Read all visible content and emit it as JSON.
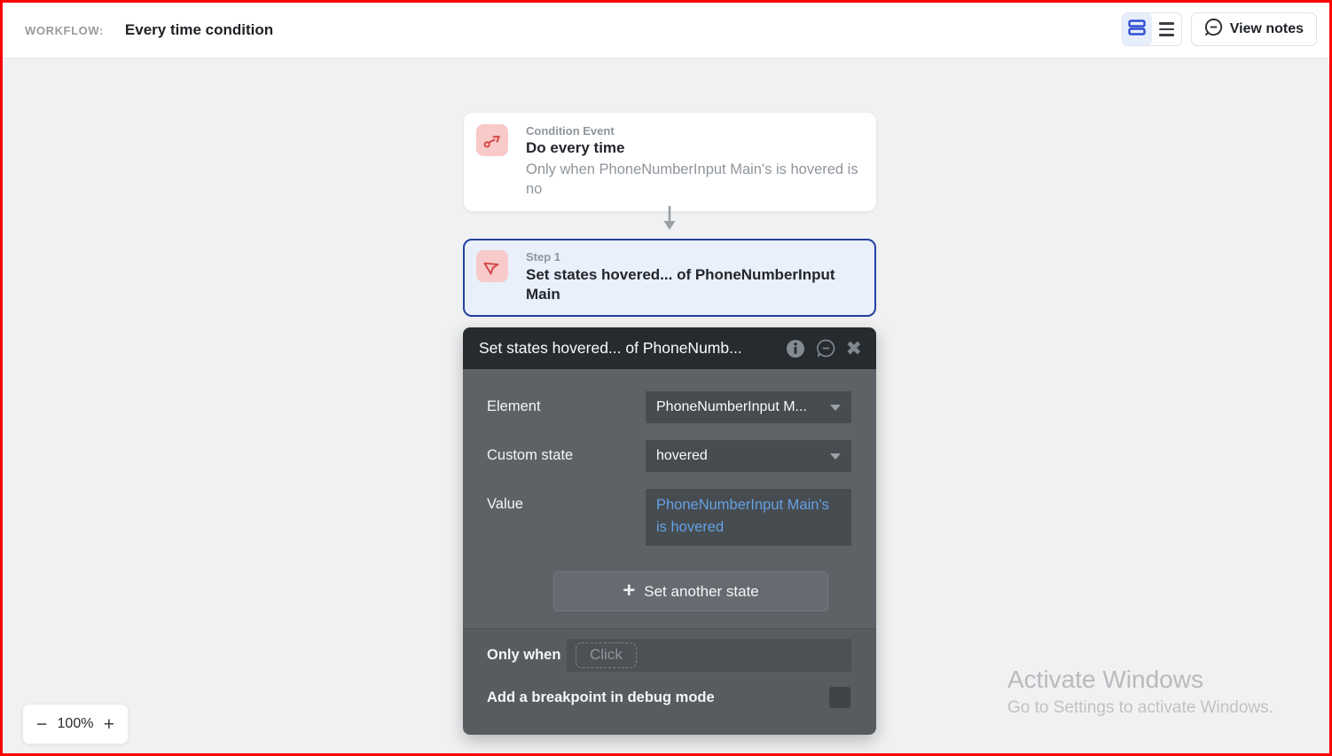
{
  "topbar": {
    "workflow_label": "WORKFLOW:",
    "title": "Every time condition",
    "view_notes_label": "View notes"
  },
  "canvas": {
    "condition_event": {
      "kind_label": "Condition Event",
      "title": "Do every time",
      "description": "Only when PhoneNumberInput Main's is hovered is no"
    },
    "step": {
      "kind_label": "Step 1",
      "title": "Set states hovered... of PhoneNumberInput Main"
    }
  },
  "panel": {
    "title": "Set states hovered... of PhoneNumb...",
    "fields": [
      {
        "label": "Element",
        "value": "PhoneNumberInput M...",
        "type": "dropdown"
      },
      {
        "label": "Custom state",
        "value": "hovered",
        "type": "dropdown"
      },
      {
        "label": "Value",
        "value": "PhoneNumberInput Main's is hovered",
        "type": "expression"
      }
    ],
    "add_state_label": "Set another state",
    "only_when": {
      "label": "Only when",
      "placeholder": "Click"
    },
    "breakpoint_label": "Add a breakpoint in debug mode"
  },
  "zoom_control": {
    "zoom_out": "−",
    "level": "100%",
    "zoom_in": "+"
  },
  "watermark": {
    "title": "Activate Windows",
    "subtitle": "Go to Settings to activate Windows."
  },
  "colors": {
    "frame_border": "#fe0000",
    "canvas_bg": "#f0f1f2",
    "accent_blue": "#2f4fd4",
    "step_border": "#24419f",
    "step_bg": "#e9f0fc",
    "icon_bg_pink": "#f8caca",
    "icon_red": "#d64949",
    "panel_header_bg": "#262b2f",
    "panel_body_bg": "#5d6267",
    "panel_input_bg": "#474c50",
    "expression_blue": "#64a0e4"
  }
}
